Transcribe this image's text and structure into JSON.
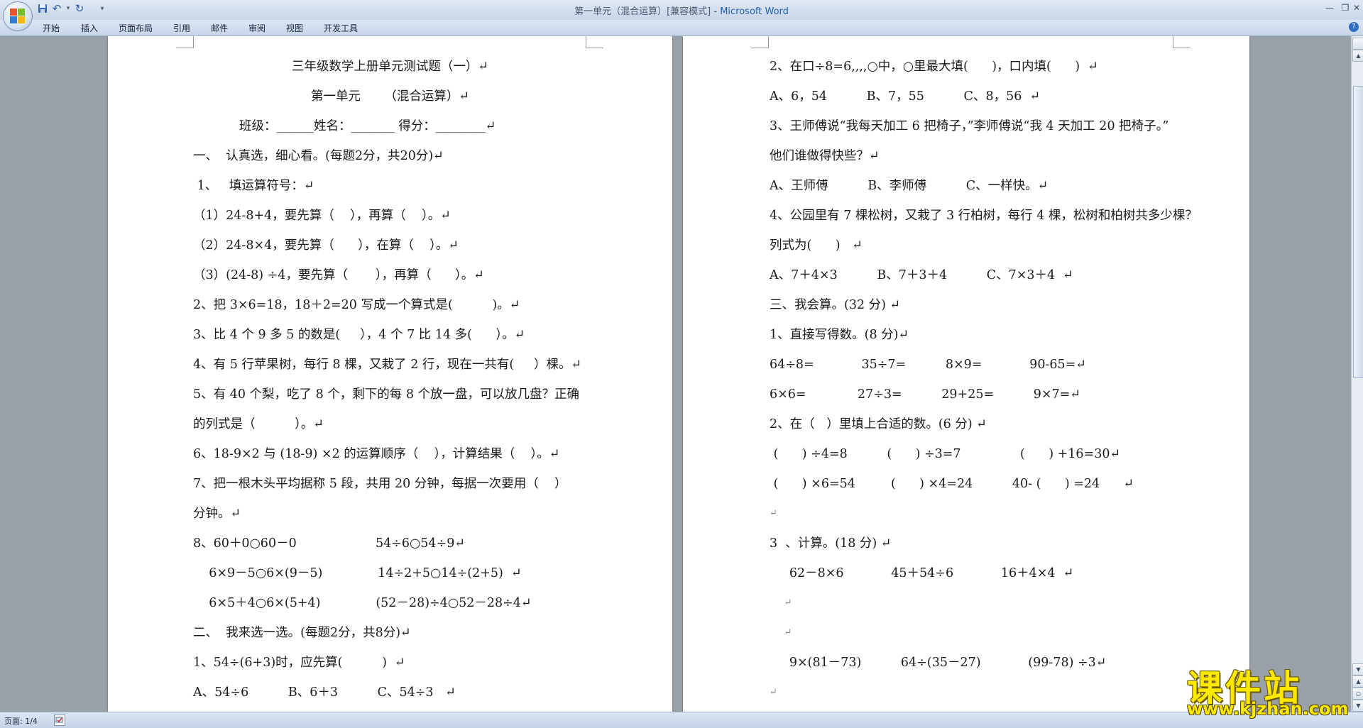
{
  "window": {
    "title": "第一单元（混合运算）[兼容模式] - ",
    "app_name": "Microsoft Word"
  },
  "ribbon": {
    "tabs": [
      "开始",
      "插入",
      "页面布局",
      "引用",
      "邮件",
      "审阅",
      "视图",
      "开发工具"
    ],
    "help_glyph": "?"
  },
  "icons": {
    "save": "save-icon",
    "undo": "undo-icon",
    "redo": "redo-icon",
    "customize": "dropdown-arrow-icon",
    "minimize": "minimize-icon",
    "restore": "restore-icon",
    "close": "close-icon",
    "glyphs": {
      "undo": "↶",
      "redo": "↻",
      "customize": "▾",
      "minimize": "—",
      "restore": "❐",
      "close": "✕",
      "up": "▲",
      "down": "▼",
      "prev_page": "▲",
      "next_page": "▼",
      "page_select": "○"
    }
  },
  "left_page": [
    "三年级数学上册单元测试题（一）↵",
    "第一单元      （混合运算）↵",
    "班级：______姓名：_______ 得分：________↵",
    "一、  认真选，细心看。(每题2分，共20分)↵",
    " 1、   填运算符号：↵",
    "（1）24-8+4，要先算（    ），再算（    ）。↵",
    "（2）24-8×4，要先算（      ），在算（    ）。↵",
    "（3）(24-8) ÷4，要先算（       ），再算（      ）。↵",
    "2、把 3×6=18，18＋2=20 写成一个算式是(          )。↵",
    "3、比 4 个 9 多 5 的数是(     ），4 个 7 比 14 多(      ）。↵",
    "4、有 5 行苹果树，每行 8 棵，又栽了 2 行，现在一共有(     ）棵。↵",
    "5、有 40 个梨，吃了 8 个，剩下的每 8 个放一盘，可以放几盘？正确",
    "的列式是（          ）。↵",
    "6、18-9×2 与 (18-9) ×2 的运算顺序（    ），计算结果（    ）。↵",
    "7、把一根木头平均据称 5 段，共用 20 分钟，每据一次要用（    ）",
    "分钟。↵",
    "8、60＋0○60－0                    54÷6○54÷9↵",
    "    6×9－5○6×(9－5)              14÷2+5○14÷(2+5)  ↵",
    "    6×5＋4○6×(5+4)              (52－28)÷4○52－28÷4↵",
    "二、  我来选一选。(每题2分，共8分)↵",
    "1、54÷(6+3)时，应先算(          )  ↵",
    "A、54÷6          B、6＋3          C、54÷3   ↵"
  ],
  "right_page": [
    "2、在口÷8=6,,,,○中，○里最大填(      )，口内填(      )  ↵",
    "A、6，54          B、7，55          C、8，56  ↵",
    "3、王师傅说“我每天加工 6 把椅子，”李师傅说“我 4 天加工 20 把椅子。”",
    "他们谁做得快些？↵",
    "A、王师傅          B、李师傅          C、一样快。↵",
    "4、公园里有 7 棵松树，又栽了 3 行柏树，每行 4 棵，松树和柏树共多少棵？",
    "列式为(      )   ↵",
    "A、7＋4×3          B、7＋3＋4          C、7×3＋4  ↵",
    "三、我会算。(32 分) ↵",
    "1、直接写得数。(8 分)↵",
    "64÷8=            35÷7=          8×9=            90-65=↵",
    "6×6=             27÷3=          29+25=          9×7=↵",
    "2、在（   ）里填上合适的数。(6 分) ↵",
    " (      ) ÷4=8          (      ) ÷3=7               (      ) +16=30↵",
    " (      ) ×6=54         (      ) ×4=24          40- (      ) =24      ↵",
    "↵",
    "3  、计算。(18 分) ↵",
    "     62－8×6            45＋54÷6            16＋4×4  ↵",
    "     ↵",
    "     ↵",
    "     9×(81－73)          64÷(35－27)            (99-78) ÷3↵",
    "↵"
  ],
  "statusbar": {
    "page_info": "页面: 1/4"
  },
  "watermark": {
    "line1": "课件站",
    "line2": "www.kjzhan.com"
  },
  "colors": {
    "workspace": "#9aa0a8",
    "ribbon_bg": "#c7d5e8",
    "app_name": "#1f5fa8",
    "watermark": "#ffe800"
  }
}
